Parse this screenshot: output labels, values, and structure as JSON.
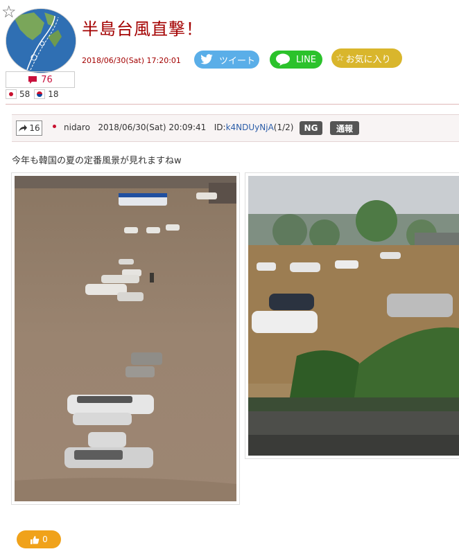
{
  "header": {
    "title": "半島台風直撃！",
    "datetime": "2018/06/30(Sat) 17:20:01",
    "share": {
      "tweet_label": "ツイート",
      "line_label": "LINE",
      "favorite_label": "お気に入り"
    },
    "comment_count": "76",
    "flags": {
      "jp_count": "58",
      "kr_count": "18"
    }
  },
  "post": {
    "share_count": "16",
    "author": "nidaro",
    "datetime": "2018/06/30(Sat) 20:09:41",
    "id_label": "ID:",
    "id_value": "k4NDUyNjA",
    "page": "(1/2)",
    "ng_label": "NG",
    "report_label": "通報",
    "text": "今年も韓国の夏の定番風景が見れますねw"
  },
  "like": {
    "count": "0"
  },
  "colors": {
    "title": "#a30000",
    "twitter": "#5aaee8",
    "line": "#2bc22b",
    "favorite": "#d9b62c",
    "like": "#f0a21a",
    "comment": "#c8103c"
  },
  "icons": [
    "star-icon",
    "speech-bubble-icon",
    "twitter-bird-icon",
    "line-icon",
    "star-outline-icon",
    "share-arrow-icon",
    "thumbs-up-icon"
  ]
}
